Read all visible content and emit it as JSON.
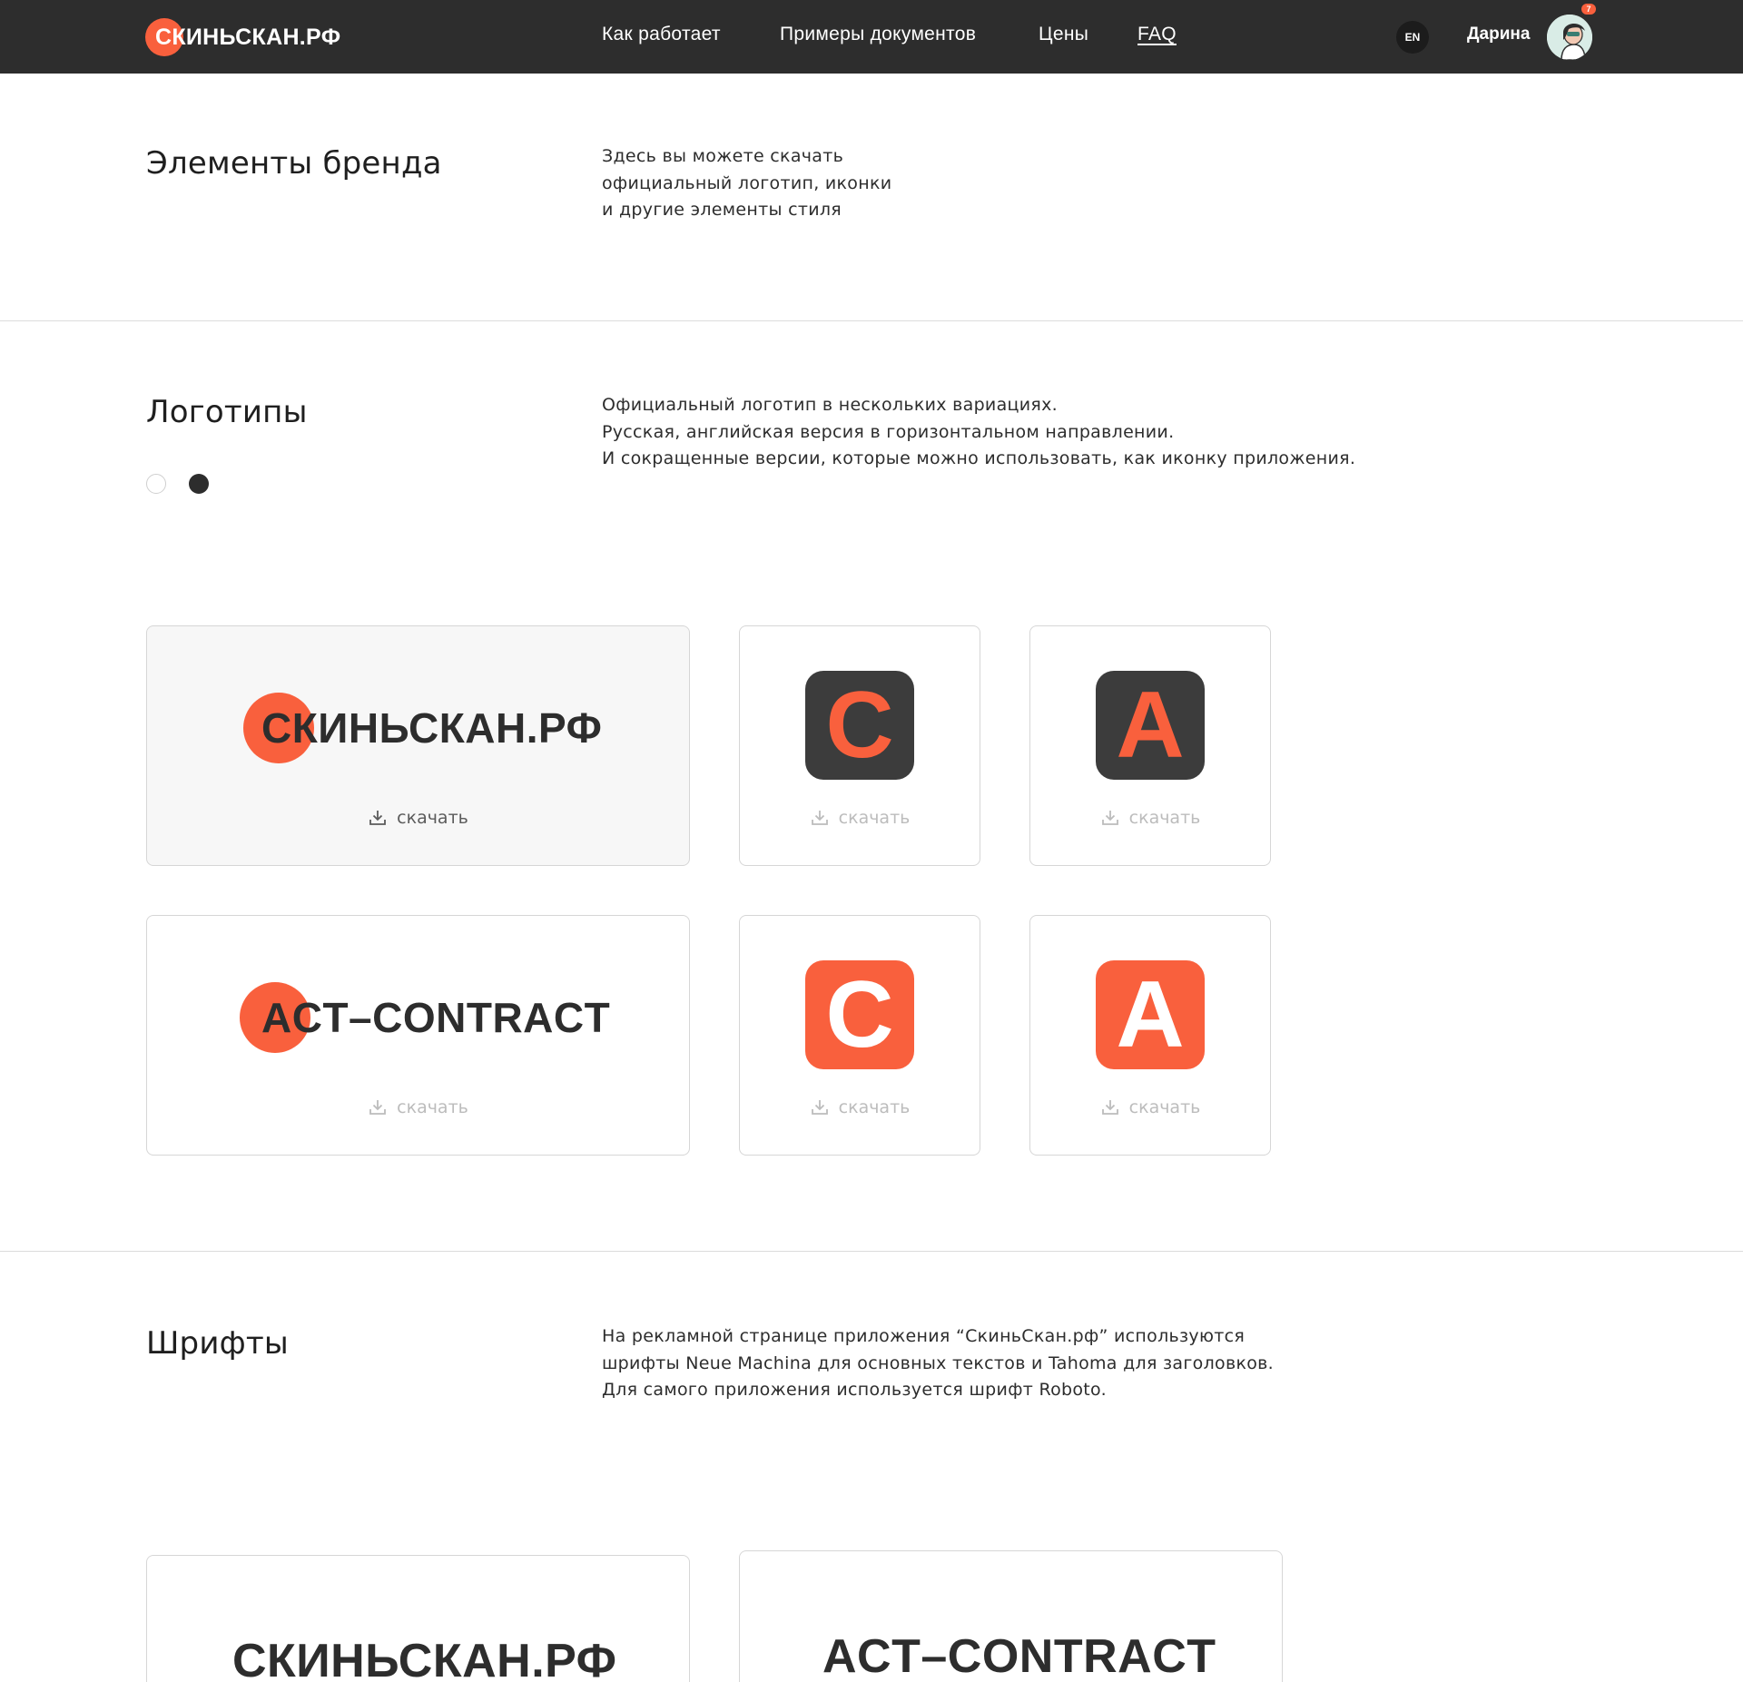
{
  "header": {
    "brand": "СКИНЬСКАН.РФ",
    "nav": [
      "Как работает",
      "Примеры документов",
      "Цены",
      "FAQ"
    ],
    "lang": "EN",
    "user": "Дарина",
    "notifications": "7"
  },
  "intro": {
    "title": "Элементы бренда",
    "lines": [
      "Здесь вы можете скачать",
      "официальный логотип, иконки",
      "и другие элементы стиля"
    ]
  },
  "logos": {
    "title": "Логотипы",
    "lines": [
      "Официальный логотип в нескольких вариациях.",
      "Русская, английская версия в горизонтальном направлении.",
      "И сокращенные версии, которые можно использовать, как иконку приложения."
    ],
    "download_label": "скачать",
    "wordmark_ru": "СКИНЬСКАН.РФ",
    "wordmark_en": "ACT–CONTRACT",
    "icon_c": "C",
    "icon_a": "A",
    "colors": {
      "accent": "#f9603d",
      "dark": "#3c3c3c"
    }
  },
  "fonts": {
    "title": "Шрифты",
    "lines": [
      "На рекламной странице приложения “СкиньСкан.рф” используются",
      "шрифты Neue Machina для основных текстов и  Tahoma для заголовков.",
      "Для самого приложения используется шрифт Roboto."
    ],
    "sample_ru": "СКИНЬСКАН.РФ",
    "sample_en": "ACT–CONTRACT"
  }
}
